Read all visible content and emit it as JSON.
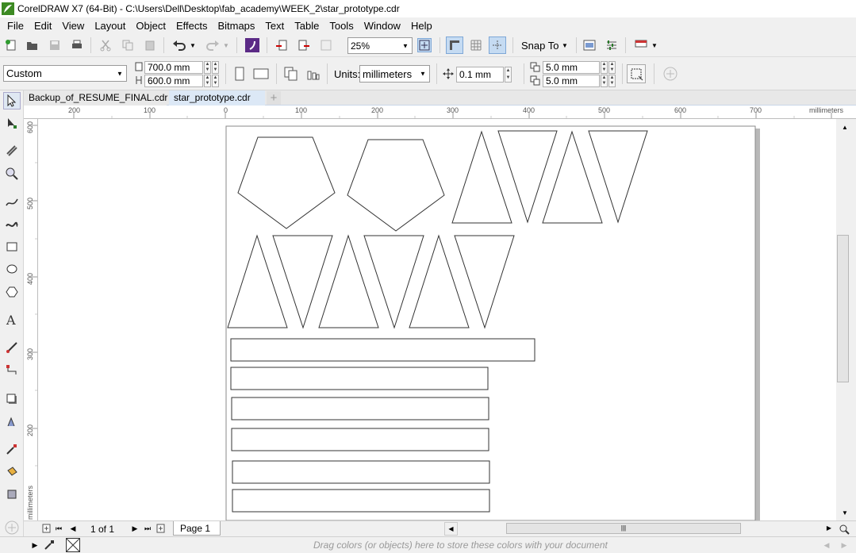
{
  "window": {
    "title": "CorelDRAW X7 (64-Bit) - C:\\Users\\Dell\\Desktop\\fab_academy\\WEEK_2\\star_prototype.cdr"
  },
  "menu": [
    "File",
    "Edit",
    "View",
    "Layout",
    "Object",
    "Effects",
    "Bitmaps",
    "Text",
    "Table",
    "Tools",
    "Window",
    "Help"
  ],
  "toolbar": {
    "zoom": "25%",
    "snap_to": "Snap To"
  },
  "property_bar": {
    "preset": "Custom",
    "width": "700.0 mm",
    "height": "600.0 mm",
    "units_label": "Units:",
    "units": "millimeters",
    "nudge": "0.1 mm",
    "dup_x": "5.0 mm",
    "dup_y": "5.0 mm"
  },
  "tabs": [
    "Backup_of_RESUME_FINAL.cdr",
    "star_prototype.cdr"
  ],
  "rulers": {
    "unit": "millimeters",
    "top_ticks": [
      "200",
      "100",
      "0",
      "100",
      "200",
      "300",
      "400",
      "500",
      "600",
      "700"
    ],
    "left_ticks": [
      "600",
      "500",
      "400",
      "300",
      "200"
    ]
  },
  "page_nav": {
    "counter": "1 of 1",
    "page_tab": "Page 1"
  },
  "palette_hint": "Drag colors (or objects) here to store these colors with your document",
  "colors": {
    "active_tab": "#dce8f6",
    "selected_button": "#c5dbf2",
    "corel_green": "#4a8f2b"
  }
}
